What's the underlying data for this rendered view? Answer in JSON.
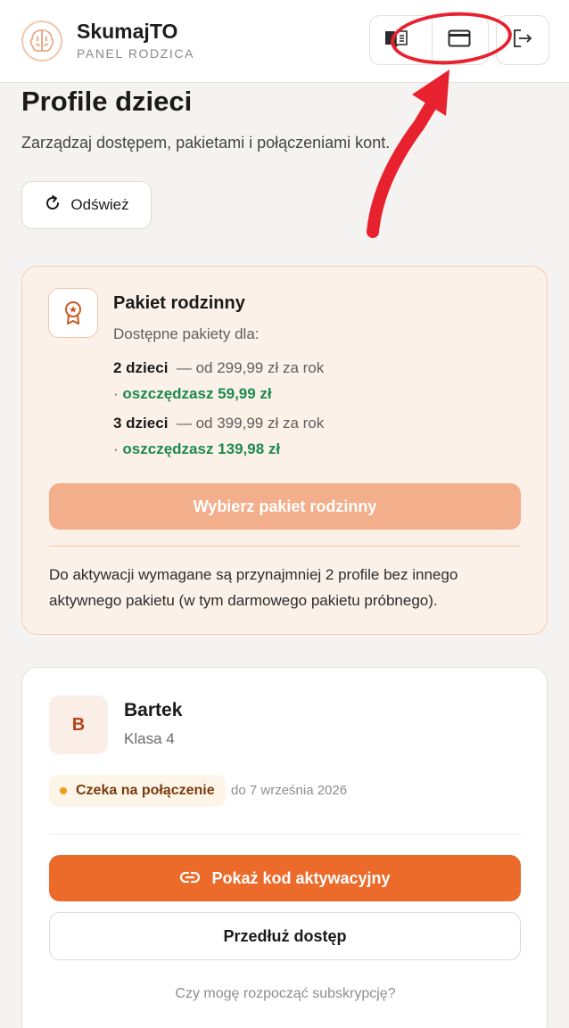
{
  "header": {
    "brand_title": "SkumajTO",
    "brand_subtitle": "PANEL RODZICA",
    "buttons": [
      "book-icon",
      "card-icon",
      "logout-icon"
    ]
  },
  "page": {
    "title": "Profile dzieci",
    "subtitle": "Zarządzaj dostępem, pakietami i połączeniami kont.",
    "refresh_label": "Odśwież"
  },
  "family_package": {
    "title": "Pakiet rodzinny",
    "available_label": "Dostępne pakiety dla:",
    "options": [
      {
        "kids": "2 dzieci",
        "price": "— od 299,99 zł za rok",
        "saving_prefix": "·",
        "saving": "oszczędzasz 59,99 zł"
      },
      {
        "kids": "3 dzieci",
        "price": "— od 399,99 zł za rok",
        "saving_prefix": "·",
        "saving": "oszczędzasz 139,98 zł"
      }
    ],
    "button_label": "Wybierz pakiet rodzinny",
    "note": "Do aktywacji wymagane są przynajmniej 2 profile bez innego aktywnego pakietu (w tym darmowego pakietu próbnego)."
  },
  "child": {
    "initial": "B",
    "name": "Bartek",
    "grade": "Klasa 4",
    "status": "Czeka na połączenie",
    "valid_until": "do 7 września 2026",
    "primary_label": "Pokaż kod aktywacyjny",
    "secondary_label": "Przedłuż dostęp",
    "faq_link": "Czy mogę rozpocząć subskrypcję?"
  },
  "colors": {
    "accent": "#ec6a2a",
    "accent_disabled": "#f3ae8b",
    "savings": "#1d8a4e",
    "annotation": "#e8212f"
  }
}
